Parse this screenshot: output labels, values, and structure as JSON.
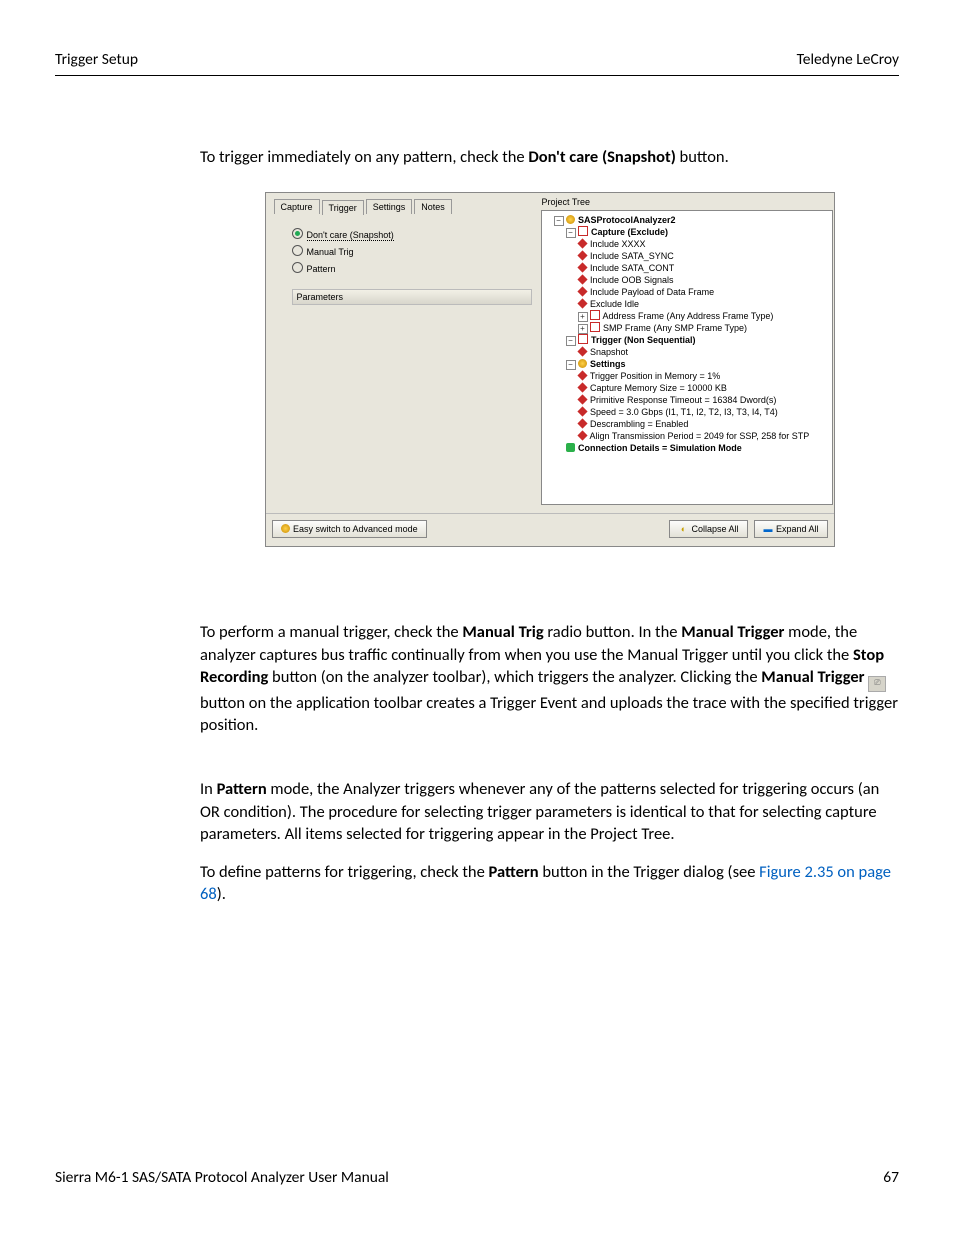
{
  "header": {
    "left": "Trigger Setup",
    "right": "Teledyne LeCroy"
  },
  "intro": {
    "t1": "To trigger immediately on any pattern, check the ",
    "b1": "Don't care (Snapshot)",
    "t2": " button."
  },
  "fig": {
    "tabs": {
      "capture": "Capture",
      "trigger": "Trigger",
      "settings": "Settings",
      "notes": "Notes"
    },
    "radios": {
      "dont_care": "Don't care (Snapshot)",
      "manual": "Manual Trig",
      "pattern": "Pattern"
    },
    "params_label": "Parameters",
    "ptree": "Project Tree",
    "tree": {
      "root": "SASProtocolAnalyzer2",
      "capture": "Capture (Exclude)",
      "c_items": [
        "Include XXXX",
        "Include SATA_SYNC",
        "Include SATA_CONT",
        "Include OOB Signals",
        "Include Payload of Data Frame",
        "Exclude Idle",
        "Address Frame (Any Address Frame Type)",
        "SMP Frame (Any SMP Frame Type)"
      ],
      "trigger": "Trigger (Non Sequential)",
      "snapshot": "Snapshot",
      "settings": "Settings",
      "s_items": [
        "Trigger Position in Memory = 1%",
        "Capture Memory Size = 10000 KB",
        "Primitive Response Timeout = 16384 Dword(s)",
        "Speed = 3.0 Gbps (I1, T1, I2, T2, I3, T3, I4, T4)",
        "Descrambling = Enabled",
        "Align Transmission Period = 2049 for SSP, 258 for STP"
      ],
      "conn": "Connection Details = Simulation Mode"
    },
    "switch": "Easy switch to Advanced mode",
    "collapse": "Collapse All",
    "expand": "Expand All"
  },
  "p2": {
    "t1": "To perform a manual trigger, check the ",
    "b1": "Manual Trig",
    "t2": " radio button. In the ",
    "b2": "Manual Trigger",
    "t3": " mode, the analyzer captures bus traffic continually from when you use the Manual Trigger until you click the ",
    "b3": "Stop Recording",
    "t4": " button (on the analyzer toolbar), which triggers the analyzer. Clicking the ",
    "b4": "Manual Trigger",
    "t5": " button on the application toolbar creates a Trigger Event and uploads the trace with the specified trigger position."
  },
  "p3": {
    "t1": "In ",
    "b1": "Pattern",
    "t2": " mode, the Analyzer triggers whenever any of the patterns selected for triggering occurs (an OR condition). The procedure for selecting trigger parameters is identical to that for selecting capture parameters. All items selected for triggering appear in the Project Tree."
  },
  "p4": {
    "t1": "To define patterns for triggering, check the ",
    "b1": "Pattern",
    "t2": " button in the Trigger dialog (see ",
    "link": "Figure 2.35 on page 68",
    "t3": ")."
  },
  "footer": {
    "left": "Sierra M6-1 SAS/SATA Protocol Analyzer User Manual",
    "page": "67"
  }
}
